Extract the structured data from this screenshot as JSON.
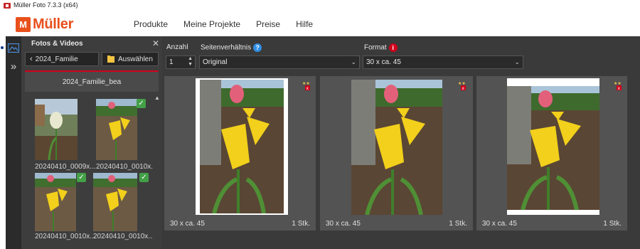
{
  "window": {
    "title": "Müller Foto 7.3.3 (x64)"
  },
  "brand": {
    "logo_letter": "M",
    "logo_text": "Müller",
    "color": "#e8501c"
  },
  "nav": {
    "items": [
      "Produkte",
      "Meine Projekte",
      "Preise",
      "Hilfe"
    ]
  },
  "sidebar": {
    "title": "Fotos & Videos",
    "back_label": "2024_Familie",
    "select_label": "Auswählen",
    "folder_name": "2024_Familie_bea",
    "thumbnails": [
      {
        "name": "20240410_0009x...",
        "checked": false
      },
      {
        "name": "20240410_0010x...",
        "checked": true
      },
      {
        "name": "20240410_0010x...",
        "checked": true
      },
      {
        "name": "20240410_0010x...",
        "checked": true
      }
    ]
  },
  "controls": {
    "anzahl_label": "Anzahl",
    "anzahl_value": "1",
    "ratio_label": "Seitenverhältnis",
    "ratio_value": "Original",
    "format_label": "Format",
    "format_value": "30 x ca. 45"
  },
  "prints": [
    {
      "format": "30 x ca. 45",
      "qty": "1 Stk."
    },
    {
      "format": "30 x ca. 45",
      "qty": "1 Stk."
    },
    {
      "format": "30 x ca. 45",
      "qty": "1 Stk."
    }
  ],
  "colors": {
    "accent_red": "#d0021b",
    "check_green": "#43a047",
    "info_blue": "#2f8fe6"
  }
}
